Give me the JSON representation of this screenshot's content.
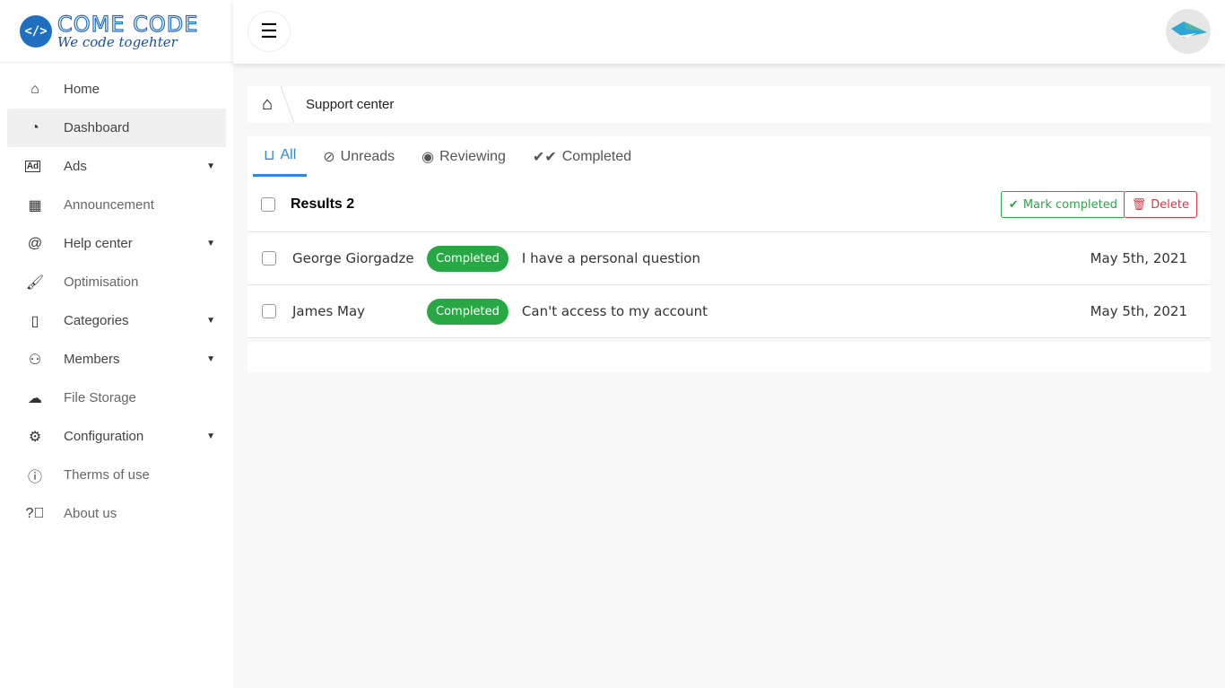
{
  "brand": {
    "logo_mark": "</>",
    "title": "COME CODE",
    "subtitle": "We code togehter"
  },
  "sidebar": {
    "items": [
      {
        "label": "Home",
        "icon": "home-icon",
        "has_caret": false
      },
      {
        "label": "Dashboard",
        "icon": "dashboard-icon",
        "has_caret": false,
        "active": true
      },
      {
        "label": "Ads",
        "icon": "ad-icon",
        "has_caret": true
      },
      {
        "label": "Announcement",
        "icon": "calendar-icon",
        "has_caret": false
      },
      {
        "label": "Help center",
        "icon": "at-icon",
        "has_caret": true
      },
      {
        "label": "Optimisation",
        "icon": "brush-icon",
        "has_caret": false
      },
      {
        "label": "Categories",
        "icon": "page-icon",
        "has_caret": true
      },
      {
        "label": "Members",
        "icon": "members-icon",
        "has_caret": true
      },
      {
        "label": "File Storage",
        "icon": "cloud-upload-icon",
        "has_caret": false
      },
      {
        "label": "Configuration",
        "icon": "gear-icon",
        "has_caret": true
      },
      {
        "label": "Therms of use",
        "icon": "accessibility-icon",
        "has_caret": false
      },
      {
        "label": "About us",
        "icon": "question-icon",
        "has_caret": false
      }
    ]
  },
  "breadcrumb": {
    "current": "Support center"
  },
  "tabs": [
    {
      "label": "All",
      "icon": "inbox-icon"
    },
    {
      "label": "Unreads",
      "icon": "eye-slash-icon"
    },
    {
      "label": "Reviewing",
      "icon": "eye-icon"
    },
    {
      "label": "Completed",
      "icon": "double-check-icon"
    }
  ],
  "list": {
    "results_label": "Results 2",
    "mark_completed": "Mark completed",
    "delete": "Delete",
    "rows": [
      {
        "name": "George Giorgadze",
        "status": "Completed",
        "subject": "I have a personal question",
        "date": "May 5th, 2021"
      },
      {
        "name": "James May",
        "status": "Completed",
        "subject": "Can't access to my account",
        "date": "May 5th, 2021"
      }
    ]
  },
  "colors": {
    "accent": "#2f86de",
    "success": "#28a745",
    "danger": "#dc3545"
  }
}
